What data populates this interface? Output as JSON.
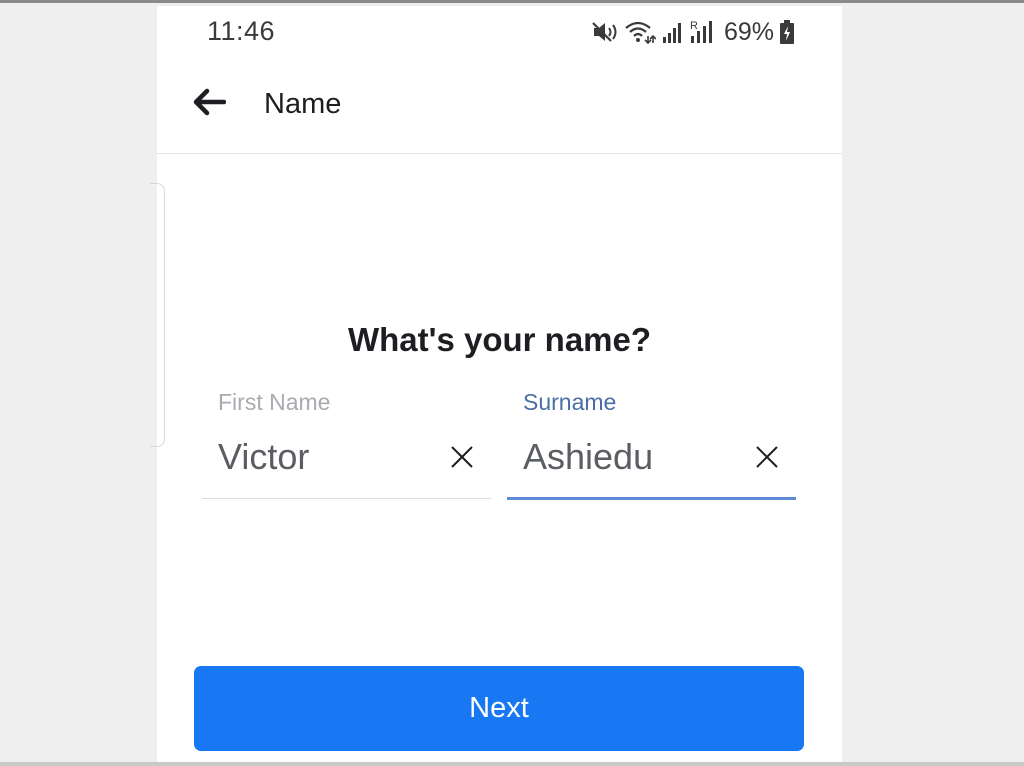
{
  "status_bar": {
    "time": "11:46",
    "battery_percent": "69%",
    "icons": [
      "mute-icon",
      "wifi-icon",
      "signal-icon",
      "roaming-signal-icon",
      "battery-charging-icon"
    ]
  },
  "app_bar": {
    "back_icon": "arrow-left-icon",
    "title": "Name"
  },
  "form": {
    "heading": "What's your name?",
    "first_name": {
      "label": "First Name",
      "value": "Victor",
      "clear_icon": "close-icon"
    },
    "surname": {
      "label": "Surname",
      "value": "Ashiedu",
      "clear_icon": "close-icon"
    },
    "next_label": "Next"
  },
  "colors": {
    "primary_button": "#1877f2",
    "focused_underline": "#5b8ad6",
    "focused_label": "#4a6fa5"
  }
}
